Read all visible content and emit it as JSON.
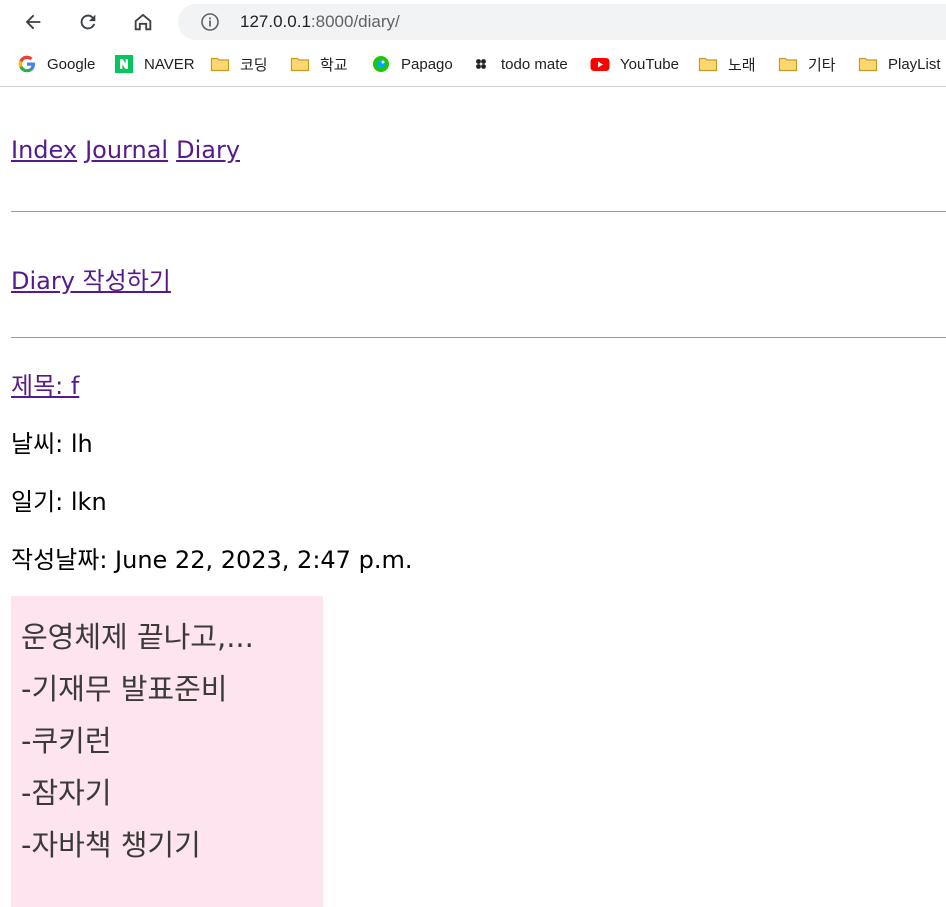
{
  "browser": {
    "url_host": "127.0.0.1",
    "url_rest": ":8000/diary/",
    "bookmarks": [
      {
        "label": "Google",
        "icon": "google-icon"
      },
      {
        "label": "NAVER",
        "icon": "naver-icon"
      },
      {
        "label": "코딩",
        "icon": "folder-icon"
      },
      {
        "label": "학교",
        "icon": "folder-icon"
      },
      {
        "label": "Papago",
        "icon": "papago-icon"
      },
      {
        "label": "todo mate",
        "icon": "todomate-icon"
      },
      {
        "label": "YouTube",
        "icon": "youtube-icon"
      },
      {
        "label": "노래",
        "icon": "folder-icon"
      },
      {
        "label": "기타",
        "icon": "folder-icon"
      },
      {
        "label": "PlayList",
        "icon": "folder-icon"
      }
    ]
  },
  "nav": {
    "index": "Index",
    "journal": "Journal",
    "diary": "Diary"
  },
  "write_link": "Diary 작성하기",
  "entry": {
    "title_label": "제목: f",
    "weather_label": "날씨: lh",
    "diary_label": "일기: lkn",
    "date_label": "작성날짜: June 22, 2023, 2:47 p.m."
  },
  "note": {
    "lines": [
      "운영체제 끝나고,...",
      "-기재무 발표준비",
      "-쿠키런",
      "-잠자기",
      "-자바책 챙기기"
    ]
  },
  "colors": {
    "visited_link": "#551a8b",
    "note_bg": "#fde4ef"
  }
}
